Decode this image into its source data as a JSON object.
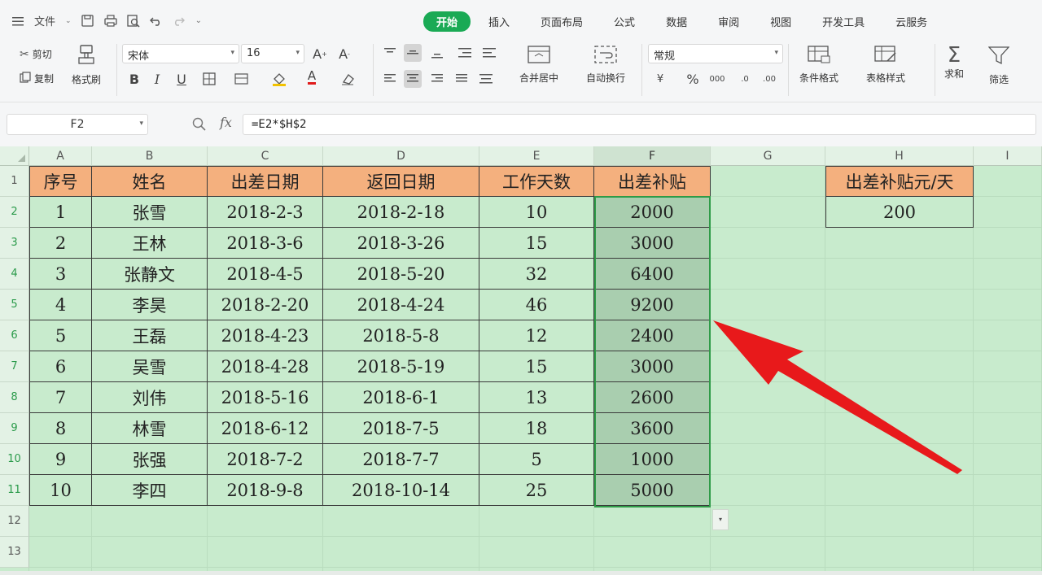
{
  "menubar": {
    "file_label": "文件",
    "tabs": [
      {
        "label": "开始",
        "active": true
      },
      {
        "label": "插入"
      },
      {
        "label": "页面布局"
      },
      {
        "label": "公式"
      },
      {
        "label": "数据"
      },
      {
        "label": "审阅"
      },
      {
        "label": "视图"
      },
      {
        "label": "开发工具"
      },
      {
        "label": "云服务"
      }
    ]
  },
  "ribbon": {
    "cut": "剪切",
    "copy": "复制",
    "format_painter": "格式刷",
    "font_name": "宋体",
    "font_size": "16",
    "merge_center": "合并居中",
    "wrap_text": "自动换行",
    "number_format": "常规",
    "conditional_format": "条件格式",
    "table_style": "表格样式",
    "sum": "求和",
    "filter": "筛选",
    "accent_color": "#1aaa55"
  },
  "formula_bar": {
    "name_box": "F2",
    "fx": "fx",
    "formula": "=E2*$H$2"
  },
  "sheet": {
    "columns": [
      "A",
      "B",
      "C",
      "D",
      "E",
      "F",
      "G",
      "H",
      "I"
    ],
    "rows": [
      "1",
      "2",
      "3",
      "4",
      "5",
      "6",
      "7",
      "8",
      "9",
      "10",
      "11",
      "12",
      "13"
    ],
    "headers": [
      "序号",
      "姓名",
      "出差日期",
      "返回日期",
      "工作天数",
      "出差补贴"
    ],
    "data": [
      [
        "1",
        "张雪",
        "2018-2-3",
        "2018-2-18",
        "10",
        "2000"
      ],
      [
        "2",
        "王林",
        "2018-3-6",
        "2018-3-26",
        "15",
        "3000"
      ],
      [
        "3",
        "张静文",
        "2018-4-5",
        "2018-5-20",
        "32",
        "6400"
      ],
      [
        "4",
        "李昊",
        "2018-2-20",
        "2018-4-24",
        "46",
        "9200"
      ],
      [
        "5",
        "王磊",
        "2018-4-23",
        "2018-5-8",
        "12",
        "2400"
      ],
      [
        "6",
        "吴雪",
        "2018-4-28",
        "2018-5-19",
        "15",
        "3000"
      ],
      [
        "7",
        "刘伟",
        "2018-5-16",
        "2018-6-1",
        "13",
        "2600"
      ],
      [
        "8",
        "林雪",
        "2018-6-12",
        "2018-7-5",
        "18",
        "3600"
      ],
      [
        "9",
        "张强",
        "2018-7-2",
        "2018-7-7",
        "5",
        "1000"
      ],
      [
        "10",
        "李四",
        "2018-9-8",
        "2018-10-14",
        "25",
        "5000"
      ]
    ],
    "rate_header": "出差补贴元/天",
    "rate_value": "200",
    "header_fill": "#f4b07e",
    "sheet_bg": "#c8ebcd",
    "arrow_color": "#e8191b"
  }
}
